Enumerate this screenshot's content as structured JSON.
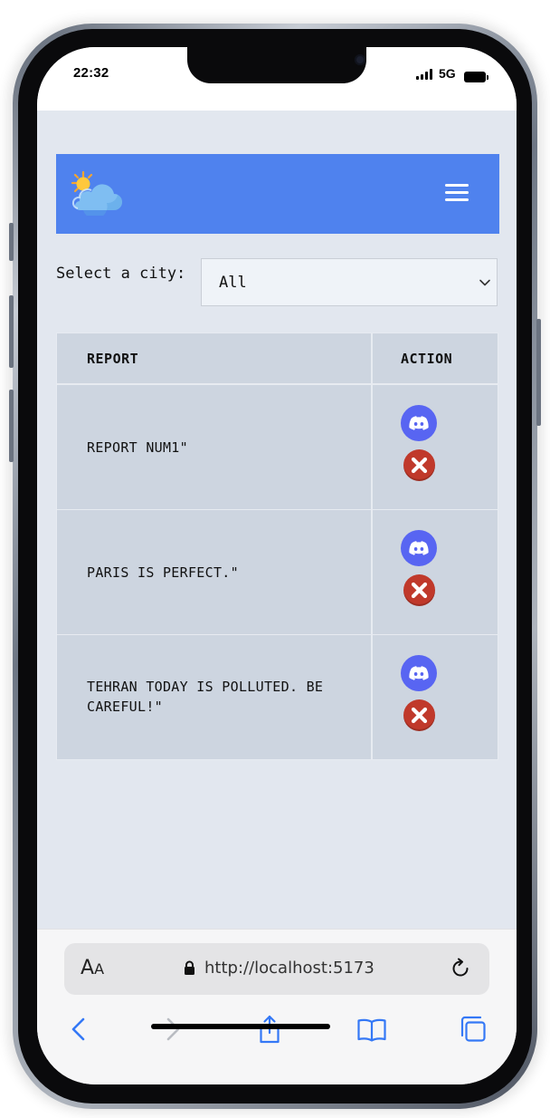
{
  "status_bar": {
    "time": "22:32",
    "network": "5G",
    "icons": [
      "signal-bars-icon",
      "battery-icon"
    ]
  },
  "navbar": {
    "logo_icon": "sun-behind-cloud-icon",
    "menu_icon": "hamburger-menu-icon",
    "background_color": "#4f82ee"
  },
  "city_filter": {
    "label": "Select a city:",
    "selected": "All"
  },
  "report_table": {
    "headers": {
      "report": "REPORT",
      "action": "ACTION"
    },
    "rows": [
      {
        "report": "REPORT NUM1\""
      },
      {
        "report": "PARIS IS PERFECT.\""
      },
      {
        "report": "TEHRAN TODAY IS POLLUTED. BE CAREFUL!\""
      }
    ],
    "action_icons": [
      "discord-icon",
      "delete-x-icon"
    ],
    "colors": {
      "discord": "#5865f2",
      "delete": "#c0392b"
    }
  },
  "browser": {
    "text_size_button": {
      "big": "A",
      "small": "A"
    },
    "url": "http://localhost:5173",
    "toolbar_icons": [
      "back-chevron-icon",
      "forward-chevron-icon",
      "share-icon",
      "bookmarks-icon",
      "tabs-icon"
    ]
  }
}
